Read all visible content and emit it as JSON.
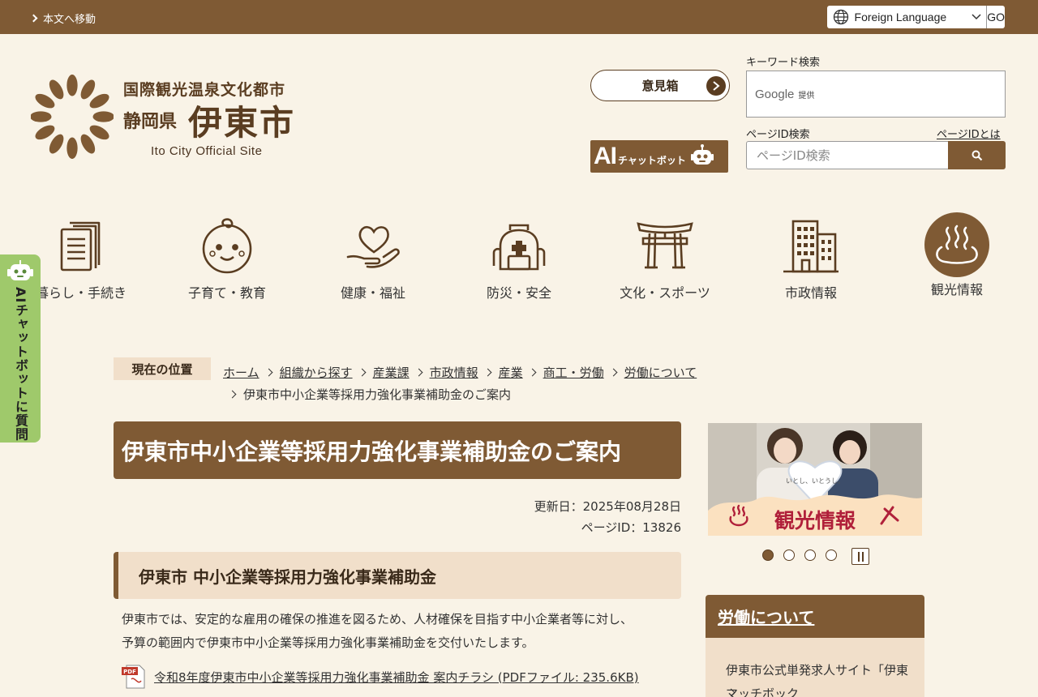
{
  "topbar": {
    "skip_link": "本文へ移動",
    "language_select": "Foreign Language",
    "language_go": "GO"
  },
  "logo": {
    "tagline": "国際観光温泉文化都市",
    "prefecture": "静岡県",
    "city": "伊東市",
    "english": "Ito City Official Site"
  },
  "header": {
    "opinion_box": "意見箱",
    "chatbot_ai": "AI",
    "chatbot_text": "チャットボット",
    "keyword_label": "キーワード検索",
    "google_word": "Google",
    "google_provided": "提供",
    "page_id_label": "ページID検索",
    "page_id_help": "ページIDとは",
    "page_id_placeholder": "ページID検索"
  },
  "nav": {
    "items": [
      {
        "label": "暮らし・手続き",
        "icon": "document-icon"
      },
      {
        "label": "子育て・教育",
        "icon": "baby-face-icon"
      },
      {
        "label": "健康・福祉",
        "icon": "heart-hand-icon"
      },
      {
        "label": "防災・安全",
        "icon": "emergency-bag-icon"
      },
      {
        "label": "文化・スポーツ",
        "icon": "torii-gate-icon"
      },
      {
        "label": "市政情報",
        "icon": "building-icon"
      },
      {
        "label": "観光情報",
        "icon": "hot-spring-icon"
      }
    ]
  },
  "side_chat": {
    "text": "AIチャットボットに質問"
  },
  "breadcrumb": {
    "label": "現在の位置",
    "items": [
      "ホーム",
      "組織から探す",
      "産業課",
      "市政情報",
      "産業",
      "商工・労働",
      "労働について"
    ],
    "current": "伊東市中小企業等採用力強化事業補助金のご案内"
  },
  "main": {
    "title": "伊東市中小企業等採用力強化事業補助金のご案内",
    "updated": "更新日：2025年08月28日",
    "page_id": "ページID：13826",
    "section_heading": "伊東市 中小企業等採用力強化事業補助金",
    "body_line1": "伊東市では、安定的な雇用の確保の推進を図るため、人材確保を目指す中小企業者等に対し、",
    "body_line2": "予算の範囲内で伊東市中小企業等採用力強化事業補助金を交付いたします。",
    "pdf_link": "令和8年度伊東市中小企業等採用力強化事業補助金 案内チラシ (PDFファイル: 235.6KB)"
  },
  "sidebar": {
    "banner_text": "観光情報",
    "banner_caption": "いとし、いとうし。",
    "slider_current": 1,
    "slider_total": 4,
    "section_heading": "労働について",
    "link_text": "伊東市公式単発求人サイト「伊東マッチボック"
  }
}
